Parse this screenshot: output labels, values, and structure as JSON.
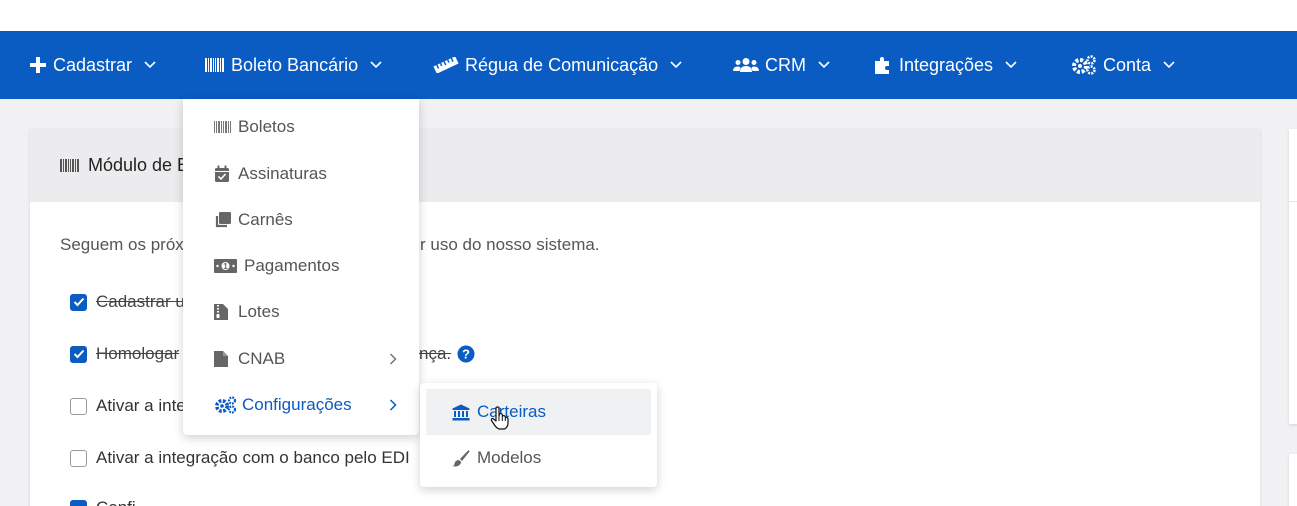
{
  "navbar": {
    "items": [
      {
        "label": "Cadastrar",
        "icon": "plus-icon"
      },
      {
        "label": "Boleto Bancário",
        "icon": "barcode-icon"
      },
      {
        "label": "Régua de Comunicação",
        "icon": "ruler-icon"
      },
      {
        "label": "CRM",
        "icon": "users-icon"
      },
      {
        "label": "Integrações",
        "icon": "puzzle-icon"
      },
      {
        "label": "Conta",
        "icon": "cogs-icon"
      }
    ]
  },
  "dropdown": {
    "items": [
      {
        "label": "Boletos",
        "icon": "barcode-icon"
      },
      {
        "label": "Assinaturas",
        "icon": "calendar-check-icon"
      },
      {
        "label": "Carnês",
        "icon": "clone-icon"
      },
      {
        "label": "Pagamentos",
        "icon": "money-bill-icon"
      },
      {
        "label": "Lotes",
        "icon": "file-archive-icon"
      },
      {
        "label": "CNAB",
        "icon": "file-icon"
      },
      {
        "label": "Configurações",
        "icon": "cogs-icon"
      }
    ]
  },
  "submenu": {
    "items": [
      {
        "label": "Carteiras",
        "icon": "bank-icon"
      },
      {
        "label": "Modelos",
        "icon": "paint-brush-icon"
      }
    ]
  },
  "card": {
    "title": "Módulo de B",
    "intro_left": "Seguem os próx",
    "intro_right": "r uso do nosso sistema."
  },
  "checklist": [
    {
      "label": "Cadastrar u",
      "checked": true
    },
    {
      "label": "Homologar",
      "label_tail": "nça.",
      "checked": true
    },
    {
      "label": "Ativar a inte",
      "checked": false
    },
    {
      "label": "Ativar a integração com o banco pelo EDI",
      "checked": false
    },
    {
      "label": "Confi",
      "checked": true
    }
  ],
  "colors": {
    "primary": "#0a5bc2",
    "header_bg": "#ececee",
    "page_bg": "#f1f1f3"
  }
}
